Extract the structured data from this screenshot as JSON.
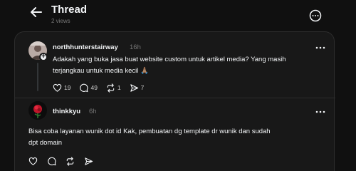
{
  "header": {
    "title": "Thread",
    "views": "2 views"
  },
  "posts": [
    {
      "username": "northhunterstairway",
      "time": "16h",
      "text_line1": "Adakah yang buka jasa buat website custom untuk artikel media? Yang masih",
      "text_line2": "terjangkau untuk media kecil 🙏🏽",
      "likes": "19",
      "replies": "49",
      "reposts": "1",
      "shares": "7"
    },
    {
      "username": "thinkkyu",
      "time": "6h",
      "text_line1": "Bisa coba layanan wunik dot id Kak, pembuatan dg template dr wunik dan sudah",
      "text_line2": "dpt domain"
    }
  ],
  "colors": {
    "background": "#101010",
    "card": "#181818",
    "text": "#f3f5f7",
    "muted": "#777777",
    "border": "#2d2d2d"
  }
}
